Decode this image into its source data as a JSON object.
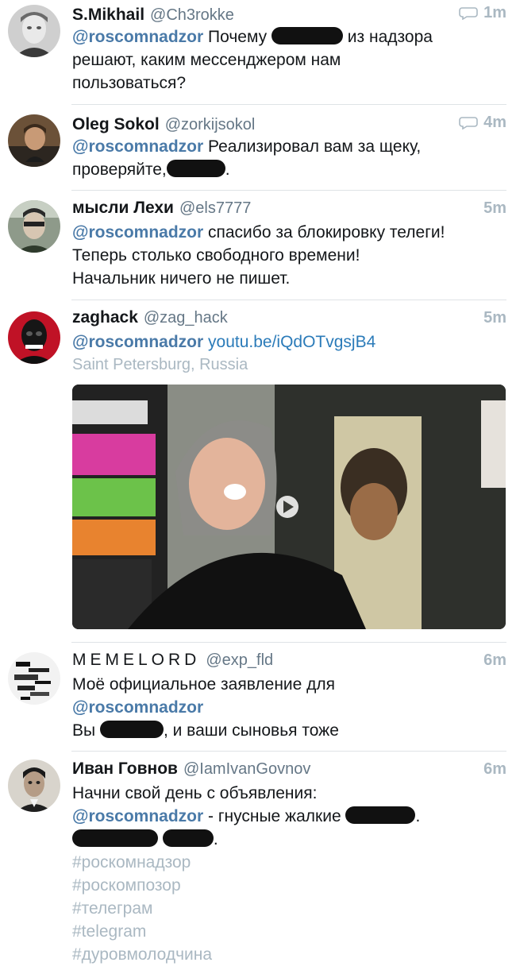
{
  "tweets": [
    {
      "name": "S.Mikhail",
      "handle": "@Ch3rokke",
      "time": "1m",
      "has_reply": true,
      "lines": [
        {
          "mention": "@roscomnadzor",
          "t1": " Почему ",
          "t2": " из надзора"
        },
        {
          "t1": "решают, каким мессенджером нам"
        },
        {
          "t1": "пользоваться?"
        }
      ]
    },
    {
      "name": "Oleg Sokol",
      "handle": "@zorkijsokol",
      "time": "4m",
      "has_reply": true,
      "lines": [
        {
          "mention": "@roscomnadzor",
          "t1": " Реализировал вам за щеку,"
        },
        {
          "t1": "проверяйте,",
          "t2": "."
        }
      ]
    },
    {
      "name": "мысли Лехи",
      "handle": "@els7777",
      "time": "5m",
      "lines": [
        {
          "mention": "@roscomnadzor",
          "t1": " спасибо за блокировку телеги!"
        },
        {
          "t1": "Теперь столько свободного времени!"
        },
        {
          "t1": "Начальник ничего не пишет."
        }
      ]
    },
    {
      "name": "zaghack",
      "handle": "@zag_hack",
      "time": "5m",
      "mention": "@roscomnadzor",
      "link": "youtu.be/iQdOTvgsjB4",
      "location": "Saint Petersburg, Russia",
      "media_icon": "play-icon"
    },
    {
      "name": "MEMELORD",
      "handle": "@exp_fld",
      "time": "6m",
      "lines": [
        {
          "t1": "Моё официальное заявление для"
        },
        {
          "mention": "@roscomnadzor"
        },
        {
          "t1": "Вы ",
          "t2": ", и ваши сыновья тоже"
        }
      ]
    },
    {
      "name": "Иван Говнов",
      "handle": "@IamIvanGovnov",
      "time": "6m",
      "lines": [
        {
          "t1": "Начни свой день с объявления:"
        },
        {
          "mention": "@roscomnadzor",
          "t1": " - гнусные жалкие ",
          "t2": "."
        },
        {
          "t2": "."
        }
      ],
      "hashtags": [
        "#роскомнадзор",
        "#роскомпозор",
        "#телеграм",
        "#telegram",
        "#дуровмолодчина"
      ]
    }
  ],
  "colors": {
    "mention": "#4a7aa8",
    "link": "#2b7bb9",
    "muted": "#aab8c2",
    "separator": "#dfe3e6"
  },
  "icons": {
    "reply": "reply-bubble-icon",
    "play": "play-icon"
  }
}
